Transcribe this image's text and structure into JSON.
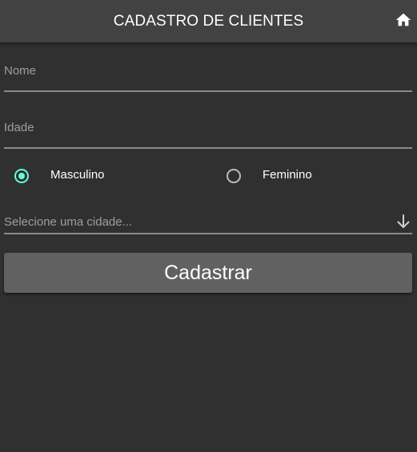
{
  "header": {
    "title": "CADASTRO DE CLIENTES",
    "home_icon": "home-icon"
  },
  "form": {
    "name_label": "Nome",
    "name_value": "",
    "age_label": "Idade",
    "age_value": "",
    "gender": {
      "options": [
        {
          "label": "Masculino",
          "checked": true
        },
        {
          "label": "Feminino",
          "checked": false
        }
      ]
    },
    "city_select": {
      "placeholder": "Selecione uma cidade...",
      "arrow_icon": "arrow-down-icon"
    },
    "submit_label": "Cadastrar"
  },
  "colors": {
    "background": "#303030",
    "toolbar": "#424242",
    "accent": "#64ffda",
    "button": "#616161"
  }
}
